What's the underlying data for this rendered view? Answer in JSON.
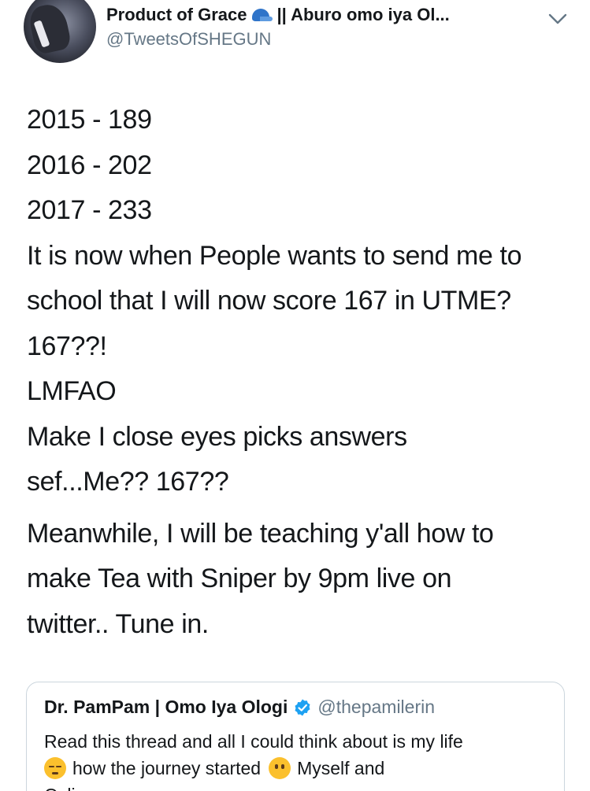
{
  "header": {
    "display_name_part1": "Product of Grace",
    "display_name_part2": "|| Aburo omo iya Ol...",
    "handle": "@TweetsOfSHEGUN",
    "cap_emoji": "blue-cap-icon",
    "menu_icon": "chevron-down-icon"
  },
  "tweet": {
    "lines": [
      "2015 - 189",
      "2016 - 202",
      "2017 - 233",
      "It is now when People wants to send me to",
      "school that I will now score 167 in UTME?",
      "167??!",
      "LMFAO",
      "Make I close eyes picks answers",
      "sef...Me?? 167??",
      "Meanwhile, I will be teaching y'all how to",
      "make Tea with Sniper by 9pm live on",
      "twitter.. Tune in."
    ]
  },
  "quote": {
    "name": "Dr. PamPam | Omo Iya Ologi",
    "handle": "@thepamilerin",
    "line1": "Read this thread and all I could think about is my life",
    "line2_a": "how the journey started",
    "line2_b": "Myself and",
    "line3": "Oclineaway...",
    "emoji1": "pensive-face-icon",
    "emoji2": "face-without-mouth-icon"
  },
  "colors": {
    "text": "#14171a",
    "secondary": "#657786",
    "border": "#ccd6dd",
    "verified": "#1da1f2"
  }
}
